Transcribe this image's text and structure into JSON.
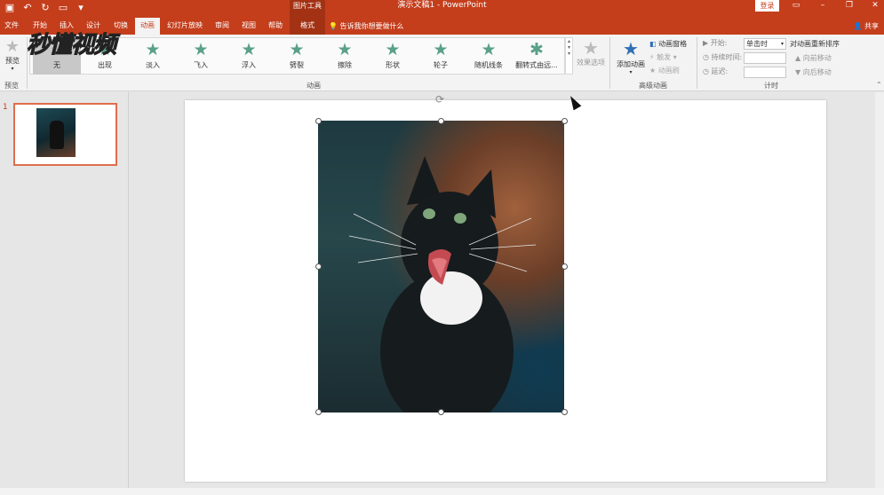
{
  "titlebar": {
    "title": "演示文稿1 - PowerPoint",
    "tools_label": "图片工具",
    "login": "登录",
    "qat_icons": [
      "save-icon",
      "undo-icon",
      "redo-icon",
      "present-icon",
      "customize-icon"
    ]
  },
  "tabs": [
    {
      "label": "文件"
    },
    {
      "label": "开始"
    },
    {
      "label": "插入"
    },
    {
      "label": "设计"
    },
    {
      "label": "切换"
    },
    {
      "label": "动画"
    },
    {
      "label": "幻灯片放映"
    },
    {
      "label": "审阅"
    },
    {
      "label": "视图"
    },
    {
      "label": "帮助"
    },
    {
      "label": "格式"
    }
  ],
  "tellme": "告诉我你想要做什么",
  "share": "共享",
  "watermark": "秒懂视频",
  "ribbon": {
    "preview": {
      "label": "预览",
      "group": "预览"
    },
    "animation_group": "动画",
    "effects": [
      {
        "label": "无"
      },
      {
        "label": "出现"
      },
      {
        "label": "淡入"
      },
      {
        "label": "飞入"
      },
      {
        "label": "浮入"
      },
      {
        "label": "劈裂"
      },
      {
        "label": "擦除"
      },
      {
        "label": "形状"
      },
      {
        "label": "轮子"
      },
      {
        "label": "随机线条"
      },
      {
        "label": "翻转式由远..."
      }
    ],
    "effect_options": "效果选项",
    "add_animation": "添加动画",
    "advanced": {
      "group": "高级动画",
      "pane": "动画窗格",
      "trigger": "触发",
      "painter": "动画刷"
    },
    "timing": {
      "group": "计时",
      "start_label": "开始:",
      "start_value": "单击时",
      "duration_label": "持续时间:",
      "delay_label": "延迟:",
      "reorder_title": "对动画重新排序",
      "move_earlier": "向前移动",
      "move_later": "向后移动"
    }
  },
  "slides": {
    "number": "1"
  }
}
